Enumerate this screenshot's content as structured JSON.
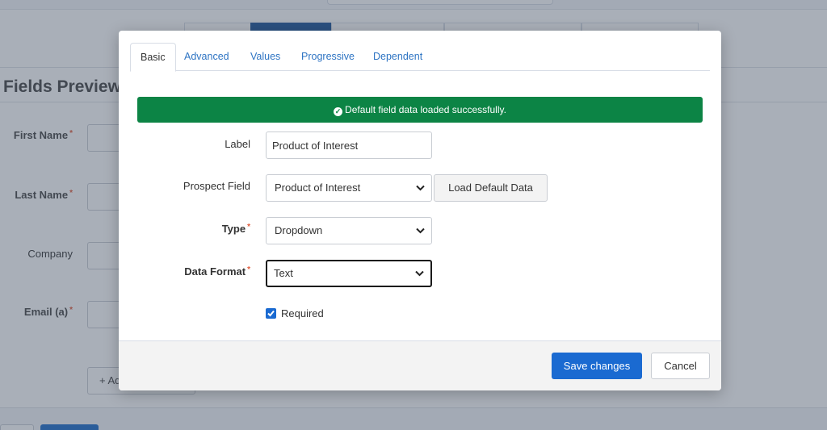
{
  "background": {
    "section_title": "Fields Preview",
    "fields": [
      {
        "label": "First Name",
        "required": "*"
      },
      {
        "label": "Last Name",
        "required": "*"
      },
      {
        "label": "Company",
        "required": ""
      },
      {
        "label": "Email (a)",
        "required": "*"
      }
    ],
    "add_button_label": "+ Add"
  },
  "modal": {
    "tabs": [
      {
        "label": "Basic",
        "active": true
      },
      {
        "label": "Advanced"
      },
      {
        "label": "Values"
      },
      {
        "label": "Progressive"
      },
      {
        "label": "Dependent"
      }
    ],
    "alert": {
      "icon": "check-circle-icon",
      "message": "Default field data loaded successfully.",
      "color": "#0c8445"
    },
    "form": {
      "label": {
        "label": "Label",
        "value": "Product of Interest"
      },
      "prospect_field": {
        "label": "Prospect Field",
        "value": "Product of Interest",
        "button_label": "Load Default Data"
      },
      "type": {
        "label": "Type",
        "required": "*",
        "value": "Dropdown"
      },
      "data_format": {
        "label": "Data Format",
        "required": "*",
        "value": "Text"
      },
      "required_checkbox": {
        "label": "Required",
        "checked": true
      }
    },
    "footer": {
      "save_label": "Save changes",
      "cancel_label": "Cancel"
    }
  },
  "colors": {
    "primary": "#1a6ad1",
    "success": "#0c8445",
    "required": "#e0593a"
  }
}
